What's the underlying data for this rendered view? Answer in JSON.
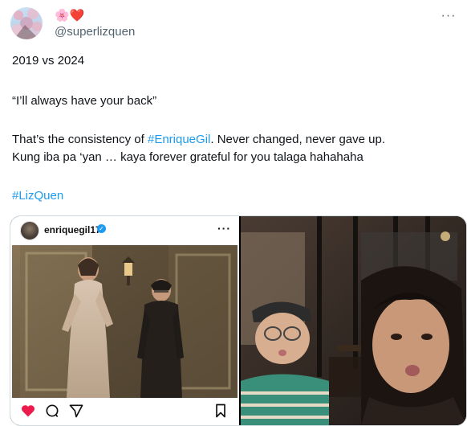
{
  "author": {
    "display_emoji": "🌸❤️",
    "handle": "@superlizquen"
  },
  "tweet": {
    "line1": "2019 vs 2024",
    "line2": "“I’ll always have your back”",
    "line3_prefix": "That’s the consistency of ",
    "line3_hashtag": "#EnriqueGil",
    "line3_suffix": ". Never changed, never gave up.",
    "line4": "Kung iba pa ‘yan … kaya forever grateful for you talaga hahahaha",
    "line5_hashtag": "#LizQuen"
  },
  "embedded_post": {
    "username": "enriquegil17",
    "verified_mark": "✓",
    "more_label": "···"
  },
  "more_label": "···",
  "icons": [
    "more-icon",
    "verified-icon",
    "heart-icon",
    "comment-icon",
    "share-icon",
    "bookmark-icon"
  ],
  "colors": {
    "link": "#1d9bf0",
    "heart": "#ed1b4c",
    "muted": "#536471"
  }
}
